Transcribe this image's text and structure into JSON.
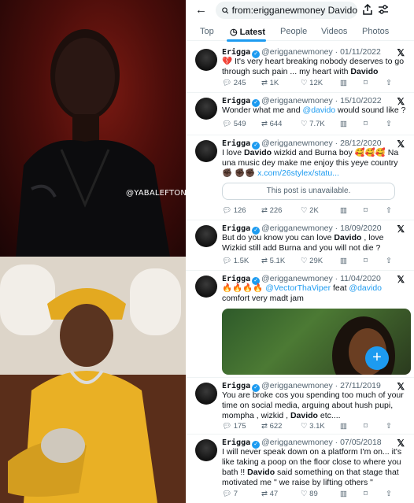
{
  "watermark": "@YABALEFTONLINE",
  "search": {
    "query": "from:erigganewmoney Davido"
  },
  "tabs": [
    "Top",
    "Latest",
    "People",
    "Videos",
    "Photos"
  ],
  "colors": {
    "accent": "#1d9bf0",
    "text": "#0f1419",
    "muted": "#536471"
  },
  "icons": [
    "back-arrow-icon",
    "search-icon",
    "share-icon",
    "filter-icon",
    "verified-icon",
    "x-logo-icon",
    "reply-icon",
    "retweet-icon",
    "like-icon",
    "views-icon",
    "share-icon",
    "plus-icon"
  ],
  "tweets": [
    {
      "name": "Erigga",
      "handle": "@erigganewmoney",
      "date": "01/11/2022",
      "pre": "💔 It's very heart breaking nobody deserves to go through such pain ... my heart with ",
      "bold": "Davido",
      "post": "",
      "replies": "245",
      "retweets": "1K",
      "likes": "12K"
    },
    {
      "name": "Erigga",
      "handle": "@erigganewmoney",
      "date": "15/10/2022",
      "pre": "Wonder what me and ",
      "mention": "@davido",
      "post": " would sound like ?",
      "replies": "549",
      "retweets": "644",
      "likes": "7.7K"
    },
    {
      "name": "Erigga",
      "handle": "@erigganewmoney",
      "date": "28/12/2020",
      "pre": "I love ",
      "bold": "Davido",
      "post": " wizkid and Burna boy 🥰🥰🥰 Na una music dey make me enjoy this yeye country ✊🏿 ✊🏿✊🏿 ",
      "link": "x.com/26stylex/statu...",
      "unavailable": "This post is unavailable.",
      "replies": "126",
      "retweets": "226",
      "likes": "2K"
    },
    {
      "name": "Erigga",
      "handle": "@erigganewmoney",
      "date": "18/09/2020",
      "pre": "But do you know you can love ",
      "bold": "Davido",
      "post": " , love Wizkid still add Burna and you will not die ?",
      "replies": "1.5K",
      "retweets": "5.1K",
      "likes": "29K"
    },
    {
      "name": "Erigga",
      "handle": "@erigganewmoney",
      "date": "11/04/2020",
      "pre": "🔥🔥🔥🔥 ",
      "mention": "@VectorThaViper",
      "mid": " feat ",
      "mention2": "@davido",
      "post": " comfort very madt jam"
    },
    {
      "name": "Erigga",
      "handle": "@erigganewmoney",
      "date": "27/11/2019",
      "pre": "You are broke cos you spending too much of your time on social media, arguing about hush pupi, mompha , wizkid , ",
      "bold": "Davido",
      "post": " etc....",
      "replies": "175",
      "retweets": "622",
      "likes": "3.1K"
    },
    {
      "name": "Erigga",
      "handle": "@erigganewmoney",
      "date": "07/05/2018",
      "pre": "I will never speak down on a platform I'm on... it's like taking a poop on the floor close to where you bath !! ",
      "bold": "Davido",
      "post": " said something on that stage that motivated me \" we raise by lifting others \"",
      "replies": "7",
      "retweets": "47",
      "likes": "89"
    }
  ]
}
